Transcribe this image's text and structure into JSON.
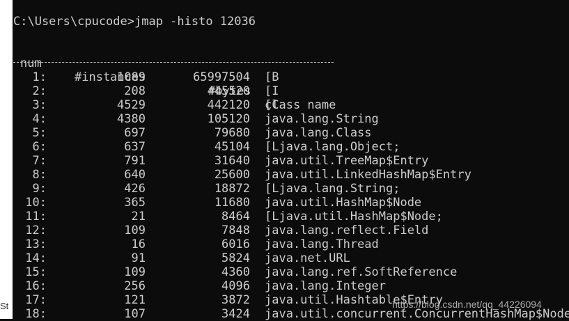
{
  "terminal": {
    "prompt_line": "C:\\Users\\cpucode>jmap -histo 12036",
    "headers": {
      "num": "num",
      "instances": "#instances",
      "bytes": "#bytes",
      "class_name": "class name"
    },
    "rows": [
      {
        "num": "1:",
        "instances": "1089",
        "bytes": "65997504",
        "class_name": "[B"
      },
      {
        "num": "2:",
        "instances": "208",
        "bytes": "445520",
        "class_name": "[I"
      },
      {
        "num": "3:",
        "instances": "4529",
        "bytes": "442120",
        "class_name": "[C"
      },
      {
        "num": "4:",
        "instances": "4380",
        "bytes": "105120",
        "class_name": "java.lang.String"
      },
      {
        "num": "5:",
        "instances": "697",
        "bytes": "79680",
        "class_name": "java.lang.Class"
      },
      {
        "num": "6:",
        "instances": "637",
        "bytes": "45104",
        "class_name": "[Ljava.lang.Object;"
      },
      {
        "num": "7:",
        "instances": "791",
        "bytes": "31640",
        "class_name": "java.util.TreeMap$Entry"
      },
      {
        "num": "8:",
        "instances": "640",
        "bytes": "25600",
        "class_name": "java.util.LinkedHashMap$Entry"
      },
      {
        "num": "9:",
        "instances": "426",
        "bytes": "18872",
        "class_name": "[Ljava.lang.String;"
      },
      {
        "num": "10:",
        "instances": "365",
        "bytes": "11680",
        "class_name": "java.util.HashMap$Node"
      },
      {
        "num": "11:",
        "instances": "21",
        "bytes": "8464",
        "class_name": "[Ljava.util.HashMap$Node;"
      },
      {
        "num": "12:",
        "instances": "109",
        "bytes": "7848",
        "class_name": "java.lang.reflect.Field"
      },
      {
        "num": "13:",
        "instances": "16",
        "bytes": "6016",
        "class_name": "java.lang.Thread"
      },
      {
        "num": "14:",
        "instances": "91",
        "bytes": "5824",
        "class_name": "java.net.URL"
      },
      {
        "num": "15:",
        "instances": "109",
        "bytes": "4360",
        "class_name": "java.lang.ref.SoftReference"
      },
      {
        "num": "16:",
        "instances": "256",
        "bytes": "4096",
        "class_name": "java.lang.Integer"
      },
      {
        "num": "17:",
        "instances": "121",
        "bytes": "3872",
        "class_name": "java.util.Hashtable$Entry"
      },
      {
        "num": "18:",
        "instances": "107",
        "bytes": "3424",
        "class_name": "java.util.concurrent.ConcurrentHashMap$Node"
      }
    ]
  },
  "watermark": "https://blog.csdn.net/qq_44226094",
  "edge_text": "St",
  "colors": {
    "background": "#0c0c0c",
    "text": "#cccccc"
  }
}
